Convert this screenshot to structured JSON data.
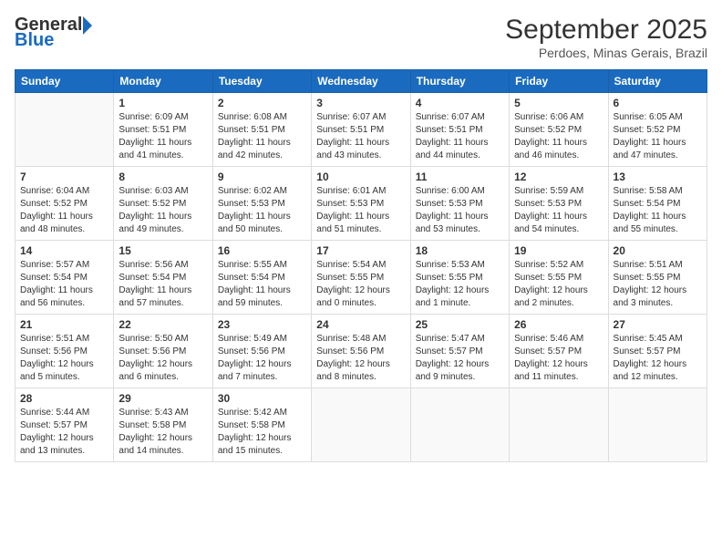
{
  "header": {
    "logo_general": "General",
    "logo_blue": "Blue",
    "month_title": "September 2025",
    "subtitle": "Perdoes, Minas Gerais, Brazil"
  },
  "days_of_week": [
    "Sunday",
    "Monday",
    "Tuesday",
    "Wednesday",
    "Thursday",
    "Friday",
    "Saturday"
  ],
  "weeks": [
    [
      {
        "day": "",
        "info": ""
      },
      {
        "day": "1",
        "info": "Sunrise: 6:09 AM\nSunset: 5:51 PM\nDaylight: 11 hours\nand 41 minutes."
      },
      {
        "day": "2",
        "info": "Sunrise: 6:08 AM\nSunset: 5:51 PM\nDaylight: 11 hours\nand 42 minutes."
      },
      {
        "day": "3",
        "info": "Sunrise: 6:07 AM\nSunset: 5:51 PM\nDaylight: 11 hours\nand 43 minutes."
      },
      {
        "day": "4",
        "info": "Sunrise: 6:07 AM\nSunset: 5:51 PM\nDaylight: 11 hours\nand 44 minutes."
      },
      {
        "day": "5",
        "info": "Sunrise: 6:06 AM\nSunset: 5:52 PM\nDaylight: 11 hours\nand 46 minutes."
      },
      {
        "day": "6",
        "info": "Sunrise: 6:05 AM\nSunset: 5:52 PM\nDaylight: 11 hours\nand 47 minutes."
      }
    ],
    [
      {
        "day": "7",
        "info": "Sunrise: 6:04 AM\nSunset: 5:52 PM\nDaylight: 11 hours\nand 48 minutes."
      },
      {
        "day": "8",
        "info": "Sunrise: 6:03 AM\nSunset: 5:52 PM\nDaylight: 11 hours\nand 49 minutes."
      },
      {
        "day": "9",
        "info": "Sunrise: 6:02 AM\nSunset: 5:53 PM\nDaylight: 11 hours\nand 50 minutes."
      },
      {
        "day": "10",
        "info": "Sunrise: 6:01 AM\nSunset: 5:53 PM\nDaylight: 11 hours\nand 51 minutes."
      },
      {
        "day": "11",
        "info": "Sunrise: 6:00 AM\nSunset: 5:53 PM\nDaylight: 11 hours\nand 53 minutes."
      },
      {
        "day": "12",
        "info": "Sunrise: 5:59 AM\nSunset: 5:53 PM\nDaylight: 11 hours\nand 54 minutes."
      },
      {
        "day": "13",
        "info": "Sunrise: 5:58 AM\nSunset: 5:54 PM\nDaylight: 11 hours\nand 55 minutes."
      }
    ],
    [
      {
        "day": "14",
        "info": "Sunrise: 5:57 AM\nSunset: 5:54 PM\nDaylight: 11 hours\nand 56 minutes."
      },
      {
        "day": "15",
        "info": "Sunrise: 5:56 AM\nSunset: 5:54 PM\nDaylight: 11 hours\nand 57 minutes."
      },
      {
        "day": "16",
        "info": "Sunrise: 5:55 AM\nSunset: 5:54 PM\nDaylight: 11 hours\nand 59 minutes."
      },
      {
        "day": "17",
        "info": "Sunrise: 5:54 AM\nSunset: 5:55 PM\nDaylight: 12 hours\nand 0 minutes."
      },
      {
        "day": "18",
        "info": "Sunrise: 5:53 AM\nSunset: 5:55 PM\nDaylight: 12 hours\nand 1 minute."
      },
      {
        "day": "19",
        "info": "Sunrise: 5:52 AM\nSunset: 5:55 PM\nDaylight: 12 hours\nand 2 minutes."
      },
      {
        "day": "20",
        "info": "Sunrise: 5:51 AM\nSunset: 5:55 PM\nDaylight: 12 hours\nand 3 minutes."
      }
    ],
    [
      {
        "day": "21",
        "info": "Sunrise: 5:51 AM\nSunset: 5:56 PM\nDaylight: 12 hours\nand 5 minutes."
      },
      {
        "day": "22",
        "info": "Sunrise: 5:50 AM\nSunset: 5:56 PM\nDaylight: 12 hours\nand 6 minutes."
      },
      {
        "day": "23",
        "info": "Sunrise: 5:49 AM\nSunset: 5:56 PM\nDaylight: 12 hours\nand 7 minutes."
      },
      {
        "day": "24",
        "info": "Sunrise: 5:48 AM\nSunset: 5:56 PM\nDaylight: 12 hours\nand 8 minutes."
      },
      {
        "day": "25",
        "info": "Sunrise: 5:47 AM\nSunset: 5:57 PM\nDaylight: 12 hours\nand 9 minutes."
      },
      {
        "day": "26",
        "info": "Sunrise: 5:46 AM\nSunset: 5:57 PM\nDaylight: 12 hours\nand 11 minutes."
      },
      {
        "day": "27",
        "info": "Sunrise: 5:45 AM\nSunset: 5:57 PM\nDaylight: 12 hours\nand 12 minutes."
      }
    ],
    [
      {
        "day": "28",
        "info": "Sunrise: 5:44 AM\nSunset: 5:57 PM\nDaylight: 12 hours\nand 13 minutes."
      },
      {
        "day": "29",
        "info": "Sunrise: 5:43 AM\nSunset: 5:58 PM\nDaylight: 12 hours\nand 14 minutes."
      },
      {
        "day": "30",
        "info": "Sunrise: 5:42 AM\nSunset: 5:58 PM\nDaylight: 12 hours\nand 15 minutes."
      },
      {
        "day": "",
        "info": ""
      },
      {
        "day": "",
        "info": ""
      },
      {
        "day": "",
        "info": ""
      },
      {
        "day": "",
        "info": ""
      }
    ]
  ]
}
